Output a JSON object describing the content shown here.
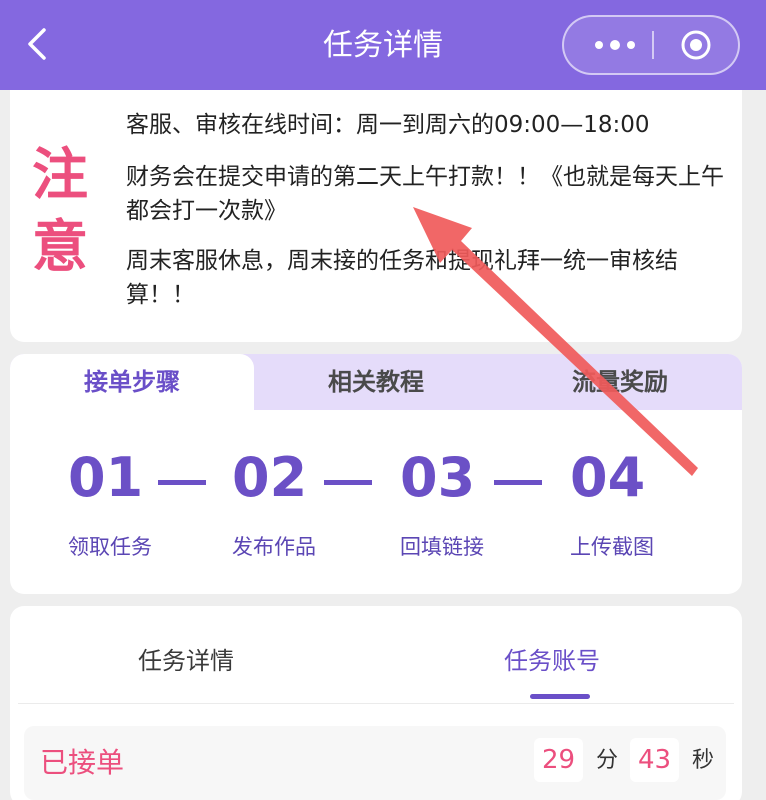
{
  "nav": {
    "title": "任务详情",
    "icons": {
      "back": "chevron-left-icon",
      "more": "more-dots-icon",
      "close": "target-circle-icon"
    }
  },
  "notice": {
    "label_1": "注",
    "label_2": "意",
    "line_1": "客服、审核在线时间：周一到周六的09:00—18:00",
    "line_2": "财务会在提交申请的第二天上午打款！！《也就是每天上午都会打一次款》",
    "line_3": "周末客服休息，周末接的任务和提现礼拜一统一审核结算！！"
  },
  "steps": {
    "tabs": [
      {
        "label": "接单步骤",
        "active": true
      },
      {
        "label": "相关教程",
        "active": false
      },
      {
        "label": "流量奖励",
        "active": false
      }
    ],
    "items": [
      {
        "num": "01",
        "label": "领取任务"
      },
      {
        "num": "02",
        "label": "发布作品"
      },
      {
        "num": "03",
        "label": "回填链接"
      },
      {
        "num": "04",
        "label": "上传截图"
      }
    ]
  },
  "detail": {
    "tabs": [
      {
        "label": "任务详情",
        "active": false
      },
      {
        "label": "任务账号",
        "active": true
      }
    ],
    "status": "已接单",
    "minutes": "29",
    "minutes_unit": "分",
    "seconds": "43",
    "seconds_unit": "秒"
  },
  "colors": {
    "nav": "#8468e0",
    "accent": "#6b50c6",
    "pink": "#ec4f7e",
    "tab_bg": "#e5dcfa",
    "arrow": "#f05a5a"
  }
}
